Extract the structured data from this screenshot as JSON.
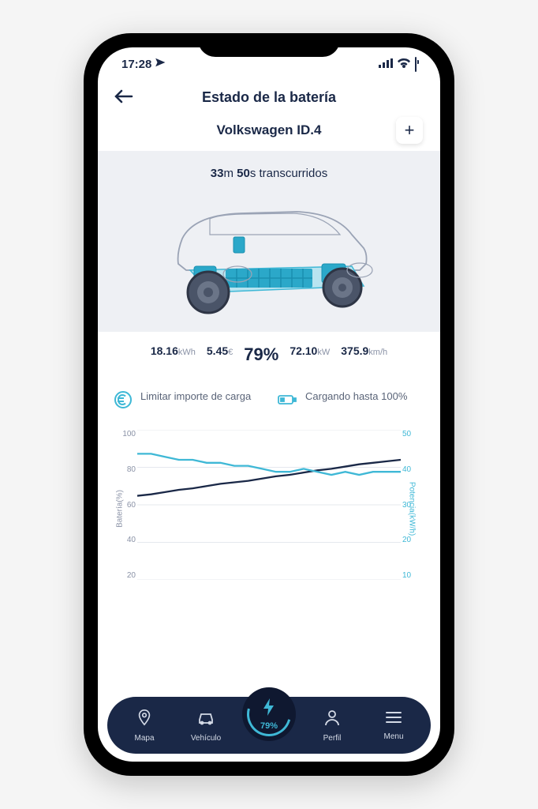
{
  "status": {
    "time": "17:28"
  },
  "header": {
    "title": "Estado de la batería"
  },
  "vehicle": {
    "name": "Volkswagen ID.4"
  },
  "elapsed": {
    "minutes": "33",
    "m_suffix": "m",
    "seconds": "50",
    "s_suffix": "s",
    "label": "transcurridos"
  },
  "stats": {
    "energy_val": "18.16",
    "energy_unit": "kWh",
    "cost_val": "5.45",
    "cost_unit": "€",
    "pct_val": "79%",
    "power_val": "72.10",
    "power_unit": "kW",
    "range_val": "375.9",
    "range_unit": "km/h"
  },
  "options": {
    "limit_label": "Limitar importe de carga",
    "charge_to_label": "Cargando hasta 100%"
  },
  "chart_data": {
    "type": "line",
    "x": [
      0,
      1,
      2,
      3,
      4,
      5,
      6,
      7,
      8,
      9,
      10,
      11,
      12,
      13,
      14,
      15,
      16,
      17,
      18,
      19
    ],
    "series": [
      {
        "name": "Batería(%)",
        "axis": "left",
        "color": "#1a2847",
        "values": [
          56,
          57,
          58.5,
          60,
          61,
          62.5,
          64,
          65,
          66,
          67.5,
          69,
          70,
          71.5,
          73,
          74,
          75.5,
          77,
          78,
          79,
          80
        ]
      },
      {
        "name": "Potencia(kW/h)",
        "axis": "right",
        "color": "#3fb8d6",
        "values": [
          42,
          42,
          41,
          40,
          40,
          39,
          39,
          38,
          38,
          37,
          36,
          36,
          37,
          36,
          35,
          36,
          35,
          36,
          36,
          36
        ]
      }
    ],
    "ylabel_left": "Batería(%)",
    "ylabel_right": "Potencia(kW/h)",
    "ylim_left": [
      0,
      100
    ],
    "ylim_right": [
      0,
      50
    ],
    "yticks_left": [
      "100",
      "80",
      "60",
      "40",
      "20"
    ],
    "yticks_right": [
      "50",
      "40",
      "30",
      "20",
      "10"
    ]
  },
  "nav": {
    "map": "Mapa",
    "vehicle": "Vehículo",
    "center_pct": "79%",
    "profile": "Perfil",
    "menu": "Menu"
  }
}
